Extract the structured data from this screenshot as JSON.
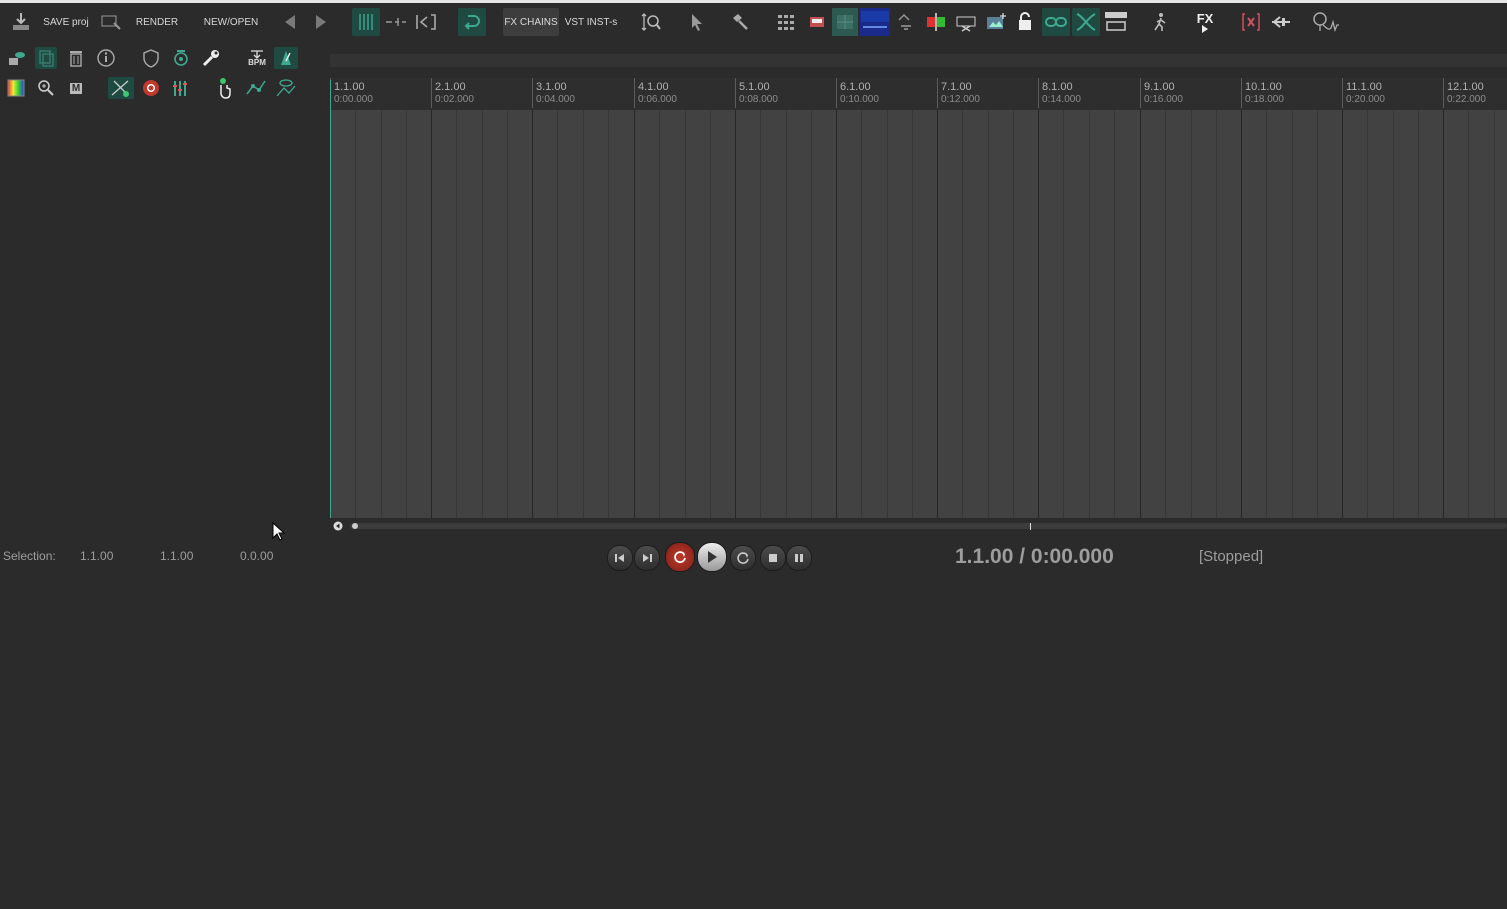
{
  "toolbar": {
    "save_label": "SAVE proj",
    "render_label": "RENDER",
    "new_open_label": "NEW/OPEN",
    "fx_chains_label": "FX CHAINS",
    "vst_inst_label": "VST INST-s",
    "fx_label": "FX"
  },
  "left_toolbar": {
    "bpm_label": "BPM",
    "m_label": "M"
  },
  "ruler": {
    "bars": [
      {
        "label": "1.1.00",
        "time": "0:00.000"
      },
      {
        "label": "2.1.00",
        "time": "0:02.000"
      },
      {
        "label": "3.1.00",
        "time": "0:04.000"
      },
      {
        "label": "4.1.00",
        "time": "0:06.000"
      },
      {
        "label": "5.1.00",
        "time": "0:08.000"
      },
      {
        "label": "6.1.00",
        "time": "0:10.000"
      },
      {
        "label": "7.1.00",
        "time": "0:12.000"
      },
      {
        "label": "8.1.00",
        "time": "0:14.000"
      },
      {
        "label": "9.1.00",
        "time": "0:16.000"
      },
      {
        "label": "10.1.00",
        "time": "0:18.000"
      },
      {
        "label": "11.1.00",
        "time": "0:20.000"
      },
      {
        "label": "12.1.00",
        "time": "0:22.000"
      }
    ]
  },
  "selection": {
    "label": "Selection:",
    "start": "1.1.00",
    "end": "1.1.00",
    "length": "0.0.00"
  },
  "transport": {
    "position": "1.1.00 / 0:00.000",
    "state": "[Stopped]"
  },
  "colors": {
    "accent_green": "#3fa88f",
    "record_red": "#c0392b",
    "background": "#2b2b2b",
    "arrange_bg": "#424242"
  }
}
